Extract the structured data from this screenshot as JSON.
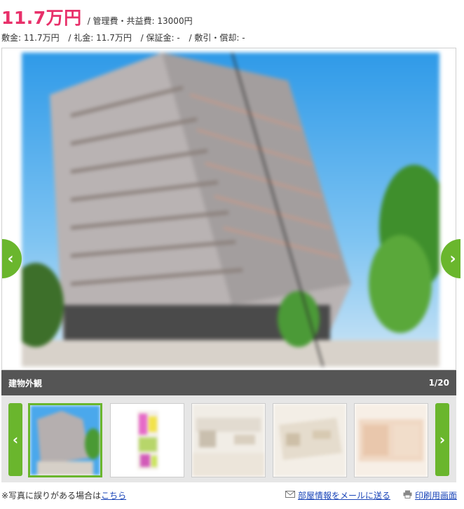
{
  "price": {
    "rent": "11.7万円",
    "fee": "/ 管理費・共益費: 13000円"
  },
  "deposits": [
    "敷金: 11.7万円",
    "/ 礼金: 11.7万円",
    "/ 保証金: -",
    "/ 敷引・償却: -"
  ],
  "gallery": {
    "caption": "建物外観",
    "counter": "1/20",
    "prev_glyph": "‹",
    "next_glyph": "›"
  },
  "footer": {
    "note_text": "※写真に誤りがある場合は",
    "note_link": "こちら",
    "mail_icon": "envelope-icon",
    "mail_link": "部屋情報をメールに送る",
    "print_icon": "printer-icon",
    "print_link": "印刷用画面"
  },
  "colors": {
    "price": "#e8306a",
    "accent_green": "#6ab62d",
    "caption_bar": "#555555",
    "link": "#1a45b8"
  }
}
